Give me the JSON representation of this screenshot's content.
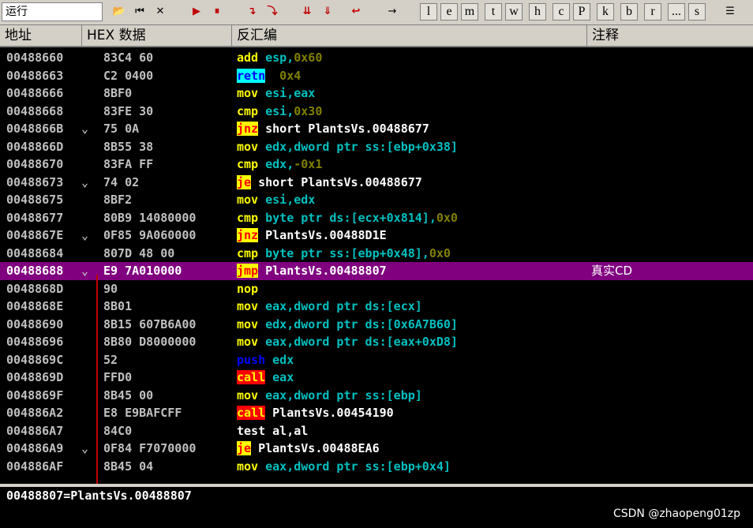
{
  "toolbar": {
    "status": "运行",
    "letters": [
      "l",
      "e",
      "m",
      "t",
      "w",
      "h",
      "c",
      "P",
      "k",
      "b",
      "r",
      "...",
      "s"
    ]
  },
  "columns": [
    "地址",
    "HEX 数据",
    "反汇编",
    "注释"
  ],
  "rows": [
    {
      "addr": "00488660",
      "mark": "",
      "hex": "83C4 60",
      "mn": "add",
      "cls": "m",
      "rest": " esp,0x60",
      "ops": "esp,",
      "num": "0x60",
      "cmt": ""
    },
    {
      "addr": "00488663",
      "mark": "",
      "hex": "C2 0400",
      "mn": "retn",
      "cls": "rt",
      "ops": "",
      "num": "0x4",
      "cmt": ""
    },
    {
      "addr": "00488666",
      "mark": "",
      "hex": "8BF0",
      "mn": "mov",
      "cls": "m",
      "ops": "esi,eax",
      "num": "",
      "cmt": ""
    },
    {
      "addr": "00488668",
      "mark": "",
      "hex": "83FE 30",
      "mn": "cmp",
      "cls": "m",
      "ops": "esi,",
      "num": "0x30",
      "cmt": ""
    },
    {
      "addr": "0048866B",
      "mark": "⌄",
      "hex": "75 0A",
      "mn": "jnz",
      "cls": "jc",
      "tgt": "short PlantsVs.00488677",
      "cmt": ""
    },
    {
      "addr": "0048866D",
      "mark": "",
      "hex": "8B55 38",
      "mn": "mov",
      "cls": "m",
      "ops": "edx,dword ptr ss:[ebp+0x38]",
      "num": "",
      "cmt": ""
    },
    {
      "addr": "00488670",
      "mark": "",
      "hex": "83FA FF",
      "mn": "cmp",
      "cls": "m",
      "ops": "edx,",
      "num": "-0x1",
      "cmt": ""
    },
    {
      "addr": "00488673",
      "mark": "⌄",
      "hex": "74 02",
      "mn": "je",
      "cls": "jc",
      "tgt": "short PlantsVs.00488677",
      "cmt": ""
    },
    {
      "addr": "00488675",
      "mark": "",
      "hex": "8BF2",
      "mn": "mov",
      "cls": "m",
      "ops": "esi,edx",
      "num": "",
      "cmt": ""
    },
    {
      "addr": "00488677",
      "mark": "",
      "hex": "80B9 14080000",
      "mn": "cmp",
      "cls": "m",
      "ops": "byte ptr ds:[ecx+0x814],",
      "num": "0x0",
      "cmt": ""
    },
    {
      "addr": "0048867E",
      "mark": "⌄",
      "hex": "0F85 9A060000",
      "mn": "jnz",
      "cls": "jc",
      "tgt": "PlantsVs.00488D1E",
      "cmt": ""
    },
    {
      "addr": "00488684",
      "mark": "",
      "hex": "807D 48 00",
      "mn": "cmp",
      "cls": "m",
      "ops": "byte ptr ss:[ebp+0x48],",
      "num": "0x0",
      "cmt": ""
    },
    {
      "addr": "00488688",
      "mark": "⌄",
      "hex": "E9 7A010000",
      "mn": "jmp",
      "cls": "jm",
      "tgt": "PlantsVs.00488807",
      "cmt": "真实CD",
      "sel": true
    },
    {
      "addr": "0048868D",
      "mark": "",
      "hex": "90",
      "mn": "nop",
      "cls": "m",
      "ops": "",
      "num": "",
      "cmt": ""
    },
    {
      "addr": "0048868E",
      "mark": "",
      "hex": "8B01",
      "mn": "mov",
      "cls": "m",
      "ops": "eax,dword ptr ds:[ecx]",
      "num": "",
      "cmt": ""
    },
    {
      "addr": "00488690",
      "mark": "",
      "hex": "8B15 607B6A00",
      "mn": "mov",
      "cls": "m",
      "ops": "edx,dword ptr ds:[0x6A7B60]",
      "num": "",
      "cmt": ""
    },
    {
      "addr": "00488696",
      "mark": "",
      "hex": "8B80 D8000000",
      "mn": "mov",
      "cls": "m",
      "ops": "eax,dword ptr ds:[eax+0xD8]",
      "num": "",
      "cmt": ""
    },
    {
      "addr": "0048869C",
      "mark": "",
      "hex": "52",
      "mn": "push",
      "cls": "ph",
      "ops": "edx",
      "num": "",
      "cmt": ""
    },
    {
      "addr": "0048869D",
      "mark": "",
      "hex": "FFD0",
      "mn": "call",
      "cls": "ca",
      "ops": "eax",
      "num": "",
      "cmt": ""
    },
    {
      "addr": "0048869F",
      "mark": "",
      "hex": "8B45 00",
      "mn": "mov",
      "cls": "m",
      "ops": "eax,dword ptr ss:[ebp]",
      "num": "",
      "cmt": ""
    },
    {
      "addr": "004886A2",
      "mark": "",
      "hex": "E8 E9BAFCFF",
      "mn": "call",
      "cls": "ca",
      "tgt": "PlantsVs.00454190",
      "cmt": ""
    },
    {
      "addr": "004886A7",
      "mark": "",
      "hex": "84C0",
      "mn": "test",
      "cls": "tst",
      "ops": "al,al",
      "num": "",
      "cmt": ""
    },
    {
      "addr": "004886A9",
      "mark": "⌄",
      "hex": "0F84 F7070000",
      "mn": "je",
      "cls": "jc",
      "tgt": "PlantsVs.00488EA6",
      "cmt": ""
    },
    {
      "addr": "004886AF",
      "mark": "",
      "hex": "8B45 04",
      "mn": "mov",
      "cls": "m",
      "ops": "eax,dword ptr ss:[ebp+0x4]",
      "num": "",
      "cmt": ""
    }
  ],
  "info": "00488807=PlantsVs.00488807",
  "watermark": "CSDN @zhaopeng01zp",
  "colors": {
    "selected_row": "#800080",
    "mnemonic": "#ffff00",
    "operand": "#00c0c0",
    "jump_bg": "#ffff00",
    "call_bg": "#ff0000"
  }
}
